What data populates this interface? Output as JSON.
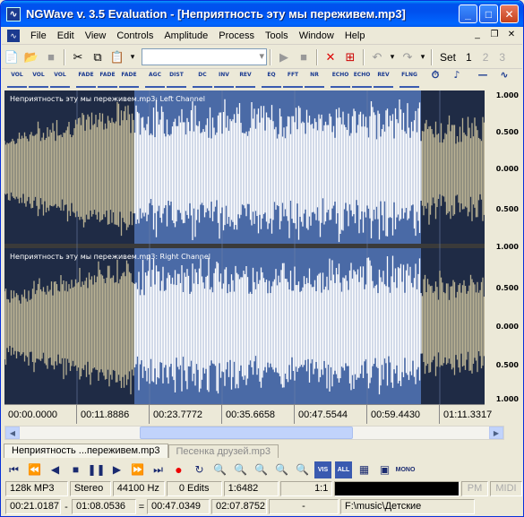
{
  "app": {
    "title": "NGWave v. 3.5 Evaluation - [Неприятность  эту  мы  переживем.mp3]",
    "icon": "app-logo-icon"
  },
  "window_buttons": [
    "minimize",
    "maximize",
    "close"
  ],
  "menu": [
    "File",
    "Edit",
    "View",
    "Controls",
    "Amplitude",
    "Process",
    "Tools",
    "Window",
    "Help"
  ],
  "toolbar": {
    "set_label": "Set",
    "presets": [
      "1",
      "2",
      "3"
    ]
  },
  "effects": [
    "VOL",
    "VOL",
    "VOL",
    "FADE",
    "FADE",
    "FADE",
    "AGC",
    "DIST",
    "DC",
    "INV",
    "REV",
    "EQ",
    "FFT",
    "NR",
    "ECHO",
    "ECHO",
    "REV",
    "FLNG"
  ],
  "channels": {
    "left": "Неприятность  эту  мы  переживем.mp3: Left Channel",
    "right": "Неприятность  эту  мы  переживем.mp3: Right Channel"
  },
  "scale": {
    "left": [
      "1.000",
      "0.500",
      "0.000",
      "0.500",
      "1.000"
    ],
    "right": [
      "1.000",
      "0.500",
      "0.000",
      "0.500",
      "1.000"
    ]
  },
  "timeline": [
    "00:00.0000",
    "00:11.8886",
    "00:23.7772",
    "00:35.6658",
    "00:47.5544",
    "00:59.4430",
    "01:11.3317"
  ],
  "tabs": [
    {
      "label": "Неприятность ...переживем.mp3",
      "active": true
    },
    {
      "label": "Песенка друзей.mp3",
      "active": false
    }
  ],
  "status": {
    "format": "128k MP3",
    "mode": "Stereo",
    "rate": "44100 Hz",
    "edits": "0 Edits",
    "ratio": "1:6482",
    "zoom": "1:1",
    "pm": "PM",
    "midi": "MIDI",
    "sel_start": "00:21.0187",
    "dash": "-",
    "sel_end": "01:08.0536",
    "equals": "=",
    "sel_len": "00:47.0349",
    "total": "02:07.8752",
    "position": "-",
    "path": "F:\\music\\Детские"
  },
  "colors": {
    "selection": "#4a6aa6",
    "wave_bg": "#1f2b45",
    "wave_dim": "#b9b193",
    "wave_sel": "#ffffff",
    "title_blue": "#0050ee"
  }
}
